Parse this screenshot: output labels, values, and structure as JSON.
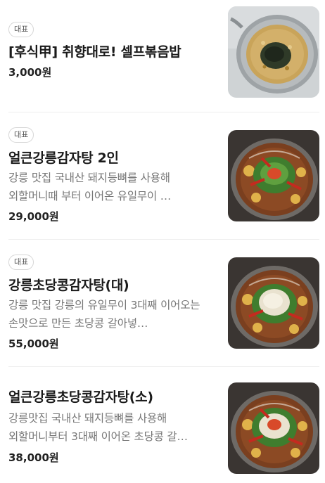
{
  "menu": {
    "items": [
      {
        "badge": "대표",
        "name": "[후식甲] 취향대로! 셀프볶음밥",
        "description": "",
        "price": "3,000원",
        "image": "fried-rice-pan"
      },
      {
        "badge": "대표",
        "name": "얼큰강릉감자탕 2인",
        "description": "강릉 맛집 국내산 돼지등뼈를 사용해 외할머니때 부터 이어온 유일무이 …",
        "price": "29,000원",
        "image": "spicy-gamjatang"
      },
      {
        "badge": "대표",
        "name": "강릉초당콩감자탕(대)",
        "description": "강릉 맛집 강릉의 유일무이 3대째 이어오는 손맛으로 만든 초당콩 갈아넣…",
        "price": "55,000원",
        "image": "chodang-bean-gamjatang"
      },
      {
        "badge": "",
        "name": "얼큰강릉초당콩감자탕(소)",
        "description": "강릉맛집 국내산 돼지등뼈를 사용해 외할머니부터 3대째 이어온 초당콩 갈…",
        "price": "38,000원",
        "image": "spicy-chodang-gamjatang"
      }
    ]
  }
}
